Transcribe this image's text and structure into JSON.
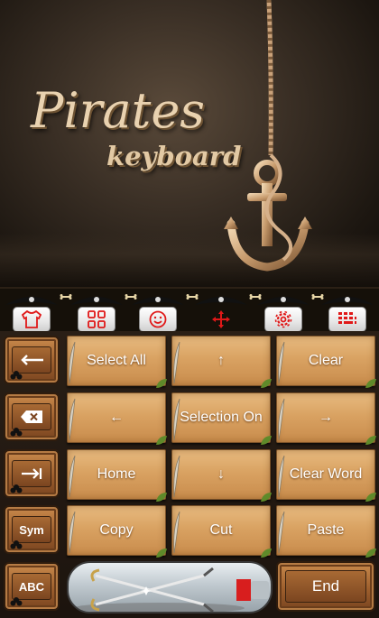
{
  "hero": {
    "title": "Pirates",
    "subtitle": "keyboard"
  },
  "tabs": [
    {
      "icon": "shirt-icon",
      "selected": false
    },
    {
      "icon": "grid-icon",
      "selected": false
    },
    {
      "icon": "smiley-icon",
      "selected": false
    },
    {
      "icon": "move-cursor-icon",
      "selected": true
    },
    {
      "icon": "settings-gear-icon",
      "selected": false
    },
    {
      "icon": "keypad-icon",
      "selected": false
    }
  ],
  "side_keys": {
    "backspace_icon": "arrow-left-icon",
    "delete_icon": "delete-x-icon",
    "tab_icon": "tab-arrow-icon",
    "sym": "Sym",
    "abc": "ABC"
  },
  "edit_keys": [
    [
      "Select All",
      "↑",
      "Clear"
    ],
    [
      "←",
      "Selection On",
      "→"
    ],
    [
      "Home",
      "↓",
      "Clear Word"
    ],
    [
      "Copy",
      "Cut",
      "Paste"
    ]
  ],
  "end_key": "End",
  "colors": {
    "accent_red": "#e01818",
    "key_wood": "#d9a262",
    "side_wood": "#9e5f2d"
  }
}
